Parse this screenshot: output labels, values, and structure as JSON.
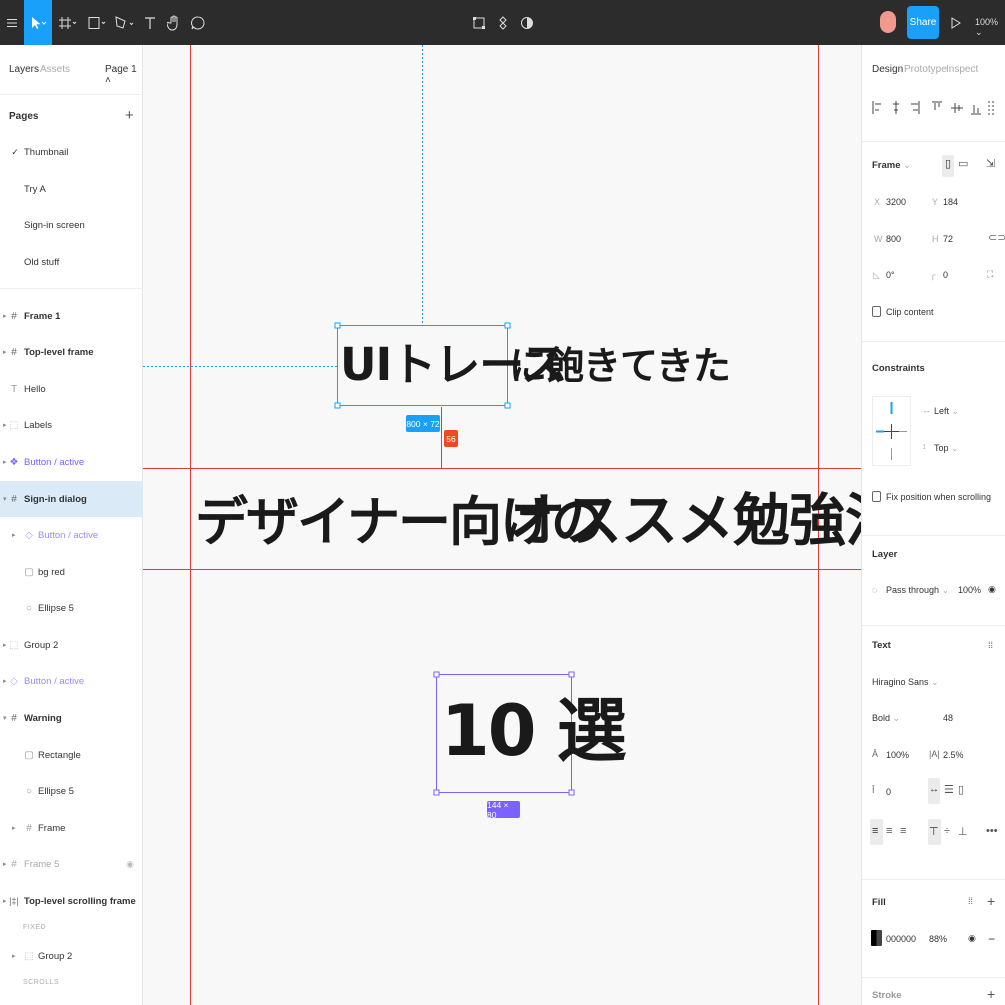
{
  "toolbar": {
    "tools": [
      "menu-icon",
      "move-icon",
      "frame-icon",
      "shape-icon",
      "pen-icon",
      "text-icon",
      "hand-icon",
      "comment-icon"
    ],
    "share_label": "Share",
    "zoom": "100%"
  },
  "left": {
    "tab_layers": "Layers",
    "tab_assets": "Assets",
    "page_selector": "Page 1",
    "pages_heading": "Pages",
    "pages": [
      "Thumbnail",
      "Try A",
      "Sign-in screen",
      "Old stuff"
    ],
    "layers": [
      {
        "label": "Frame 1"
      },
      {
        "label": "Top-level frame"
      },
      {
        "label": "Hello"
      },
      {
        "label": "Labels"
      },
      {
        "label": "Button / active"
      },
      {
        "label": "Sign-in dialog"
      },
      {
        "label": "Button / active"
      },
      {
        "label": "bg red"
      },
      {
        "label": "Ellipse 5"
      },
      {
        "label": "Group 2"
      },
      {
        "label": "Button / active"
      },
      {
        "label": "Warning"
      },
      {
        "label": "Rectangle"
      },
      {
        "label": "Ellipse 5"
      },
      {
        "label": "Frame"
      },
      {
        "label": "Frame 5"
      },
      {
        "label": "Top-level scrolling frame"
      },
      {
        "label": "Group 2"
      }
    ],
    "fixed_label": "FIXED",
    "scrolls_label": "SCROLLS"
  },
  "canvas": {
    "line1a": "UIトレース",
    "line1b": "に飽きてきた",
    "line2a": "デザイナー向けの",
    "line2b": "オススメ勉強法",
    "line3": "10 選",
    "badge1": "800 × 72",
    "badge2": "56",
    "badge3": "144 × 80"
  },
  "right": {
    "tab_design": "Design",
    "tab_prototype": "Prototype",
    "tab_inspect": "Inspect",
    "frame_label": "Frame",
    "x_key": "X",
    "x_val": "3200",
    "y_key": "Y",
    "y_val": "184",
    "w_key": "W",
    "w_val": "800",
    "h_key": "H",
    "h_val": "72",
    "rot_val": "0°",
    "radius_val": "0",
    "clip_label": "Clip content",
    "constraints_label": "Constraints",
    "c_left": "Left",
    "c_top": "Top",
    "fix_label": "Fix position when scrolling",
    "layer_label": "Layer",
    "blend": "Pass through",
    "opacity": "100%",
    "text_label": "Text",
    "font": "Hiragino Sans",
    "weight": "Bold",
    "size": "48",
    "line_height": "100%",
    "letter_spacing": "2.5%",
    "para": "0",
    "fill_label": "Fill",
    "fill_hex": "000000",
    "fill_opacity": "88%",
    "stroke_label": "Stroke"
  },
  "colors": {
    "accent": "#18a0fb",
    "guide": "#e03b3b",
    "purple": "#7b61ff",
    "badge_red": "#f24822"
  }
}
